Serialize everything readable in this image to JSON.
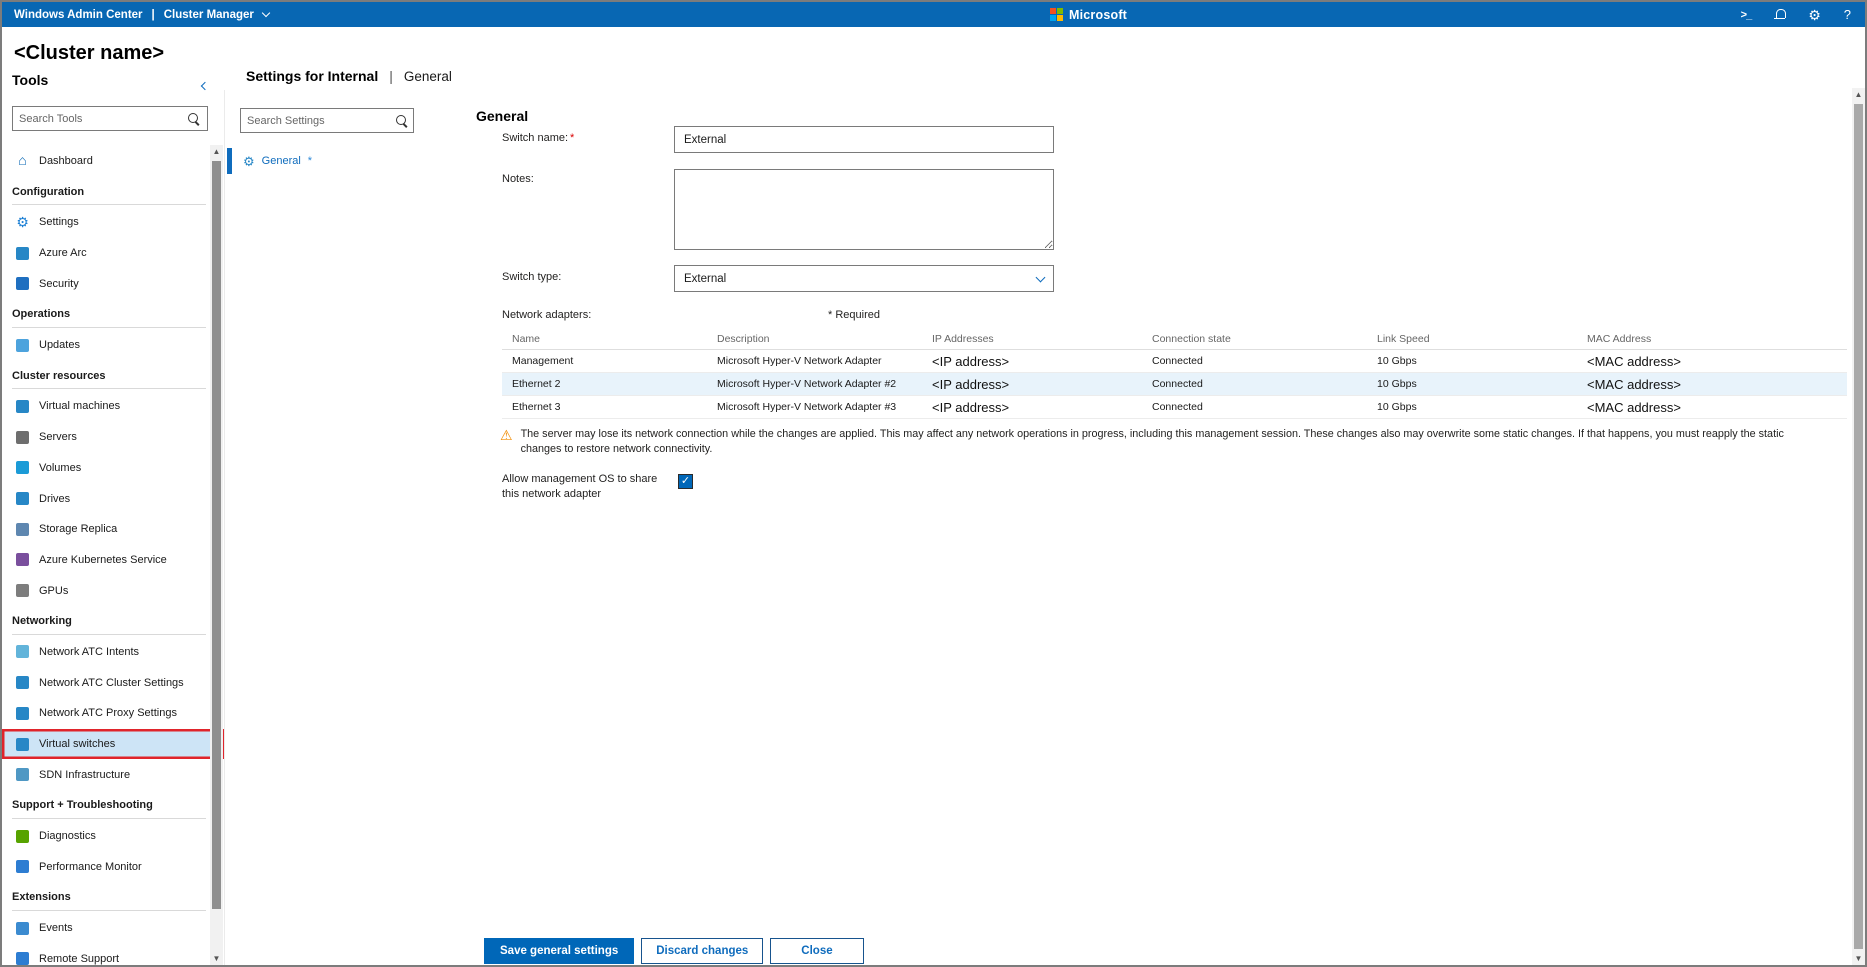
{
  "topbar": {
    "app_title": "Windows Admin Center",
    "separator": "|",
    "solution": "Cluster Manager",
    "brand": "Microsoft"
  },
  "page": {
    "cluster_name": "<Cluster name>"
  },
  "tools_panel": {
    "title": "Tools",
    "search_placeholder": "Search Tools",
    "items": [
      {
        "type": "item",
        "label": "Dashboard",
        "icon": "home-icon",
        "color": "#0b69b5",
        "glyph": "⌂"
      },
      {
        "type": "header",
        "label": "Configuration"
      },
      {
        "type": "item",
        "label": "Settings",
        "icon": "gear-icon",
        "color": "#1b7fd4",
        "glyph": "⚙"
      },
      {
        "type": "item",
        "label": "Azure Arc",
        "icon": "azure-arc-icon",
        "color": "#2787c6"
      },
      {
        "type": "item",
        "label": "Security",
        "icon": "shield-icon",
        "color": "#1f6fc0"
      },
      {
        "type": "header",
        "label": "Operations"
      },
      {
        "type": "item",
        "label": "Updates",
        "icon": "updates-icon",
        "color": "#4da3dd"
      },
      {
        "type": "header",
        "label": "Cluster resources"
      },
      {
        "type": "item",
        "label": "Virtual machines",
        "icon": "virtual-machines-icon",
        "color": "#2787c6"
      },
      {
        "type": "item",
        "label": "Servers",
        "icon": "servers-icon",
        "color": "#6e6e6e"
      },
      {
        "type": "item",
        "label": "Volumes",
        "icon": "volumes-icon",
        "color": "#1b9bd7"
      },
      {
        "type": "item",
        "label": "Drives",
        "icon": "drives-icon",
        "color": "#2787c6"
      },
      {
        "type": "item",
        "label": "Storage Replica",
        "icon": "storage-replica-icon",
        "color": "#5e87b0"
      },
      {
        "type": "item",
        "label": "Azure Kubernetes Service",
        "icon": "kubernetes-icon",
        "color": "#7a4f9d"
      },
      {
        "type": "item",
        "label": "GPUs",
        "icon": "gpu-icon",
        "color": "#7d7d7d"
      },
      {
        "type": "header",
        "label": "Networking"
      },
      {
        "type": "item",
        "label": "Network ATC Intents",
        "icon": "network-intents-icon",
        "color": "#62b4da"
      },
      {
        "type": "item",
        "label": "Network ATC Cluster Settings",
        "icon": "network-switch-icon",
        "color": "#2787c6"
      },
      {
        "type": "item",
        "label": "Network ATC Proxy Settings",
        "icon": "network-switch-icon",
        "color": "#2787c6"
      },
      {
        "type": "item",
        "label": "Virtual switches",
        "icon": "virtual-switch-icon",
        "color": "#2787c6",
        "selected": true,
        "annotated": true
      },
      {
        "type": "item",
        "label": "SDN Infrastructure",
        "icon": "sdn-icon",
        "color": "#4f98c4"
      },
      {
        "type": "header",
        "label": "Support + Troubleshooting"
      },
      {
        "type": "item",
        "label": "Diagnostics",
        "icon": "diagnostics-icon",
        "color": "#57a300"
      },
      {
        "type": "item",
        "label": "Performance Monitor",
        "icon": "performance-monitor-icon",
        "color": "#2d7dd2"
      },
      {
        "type": "header",
        "label": "Extensions"
      },
      {
        "type": "item",
        "label": "Events",
        "icon": "events-icon",
        "color": "#3b8bd0"
      },
      {
        "type": "item",
        "label": "Remote Support",
        "icon": "remote-support-icon",
        "color": "#2d7dd2"
      }
    ]
  },
  "settings_panel": {
    "title": "Settings for Internal",
    "separator": "|",
    "subtitle": "General",
    "search_placeholder": "Search Settings",
    "nav_items": [
      {
        "label": "General",
        "modified_mark": "*"
      }
    ]
  },
  "form": {
    "section_title": "General",
    "switch_name": {
      "label": "Switch name:",
      "required_mark": "*",
      "value": "External"
    },
    "notes": {
      "label": "Notes:",
      "value": ""
    },
    "switch_type": {
      "label": "Switch type:",
      "value": "External"
    },
    "network_adapters_label": "Network adapters:",
    "required_note": "* Required",
    "table": {
      "columns": [
        "Name",
        "Description",
        "IP Addresses",
        "Connection state",
        "Link Speed",
        "MAC Address"
      ],
      "rows": [
        [
          "Management",
          "Microsoft Hyper-V Network Adapter",
          "<IP address>",
          "Connected",
          "10 Gbps",
          "<MAC address>"
        ],
        [
          "Ethernet 2",
          "Microsoft Hyper-V Network Adapter #2",
          "<IP address>",
          "Connected",
          "10 Gbps",
          "<MAC address>"
        ],
        [
          "Ethernet 3",
          "Microsoft Hyper-V Network Adapter #3",
          "<IP address>",
          "Connected",
          "10 Gbps",
          "<MAC address>"
        ]
      ],
      "highlighted_row": 1
    },
    "warning": "The server may lose its network connection while the changes are applied. This may affect any network operations in progress, including this management session. These changes also may overwrite some static changes. If that happens, you must reapply the static changes to restore network connectivity.",
    "share_checkbox": {
      "label": "Allow management OS to share this network adapter",
      "checked": true
    }
  },
  "footer": {
    "save_label": "Save general settings",
    "discard_label": "Discard changes",
    "close_label": "Close"
  },
  "colors": {
    "topbar": "#0867b3",
    "accent": "#0067b8",
    "annotation_red": "#e0242b",
    "selected_item_bg": "#cde4f6",
    "row_highlight": "#e8f3fb",
    "warning_orange": "#f18b00",
    "ms_logo": [
      "#f25022",
      "#7fba00",
      "#00a4ef",
      "#ffb900"
    ]
  }
}
